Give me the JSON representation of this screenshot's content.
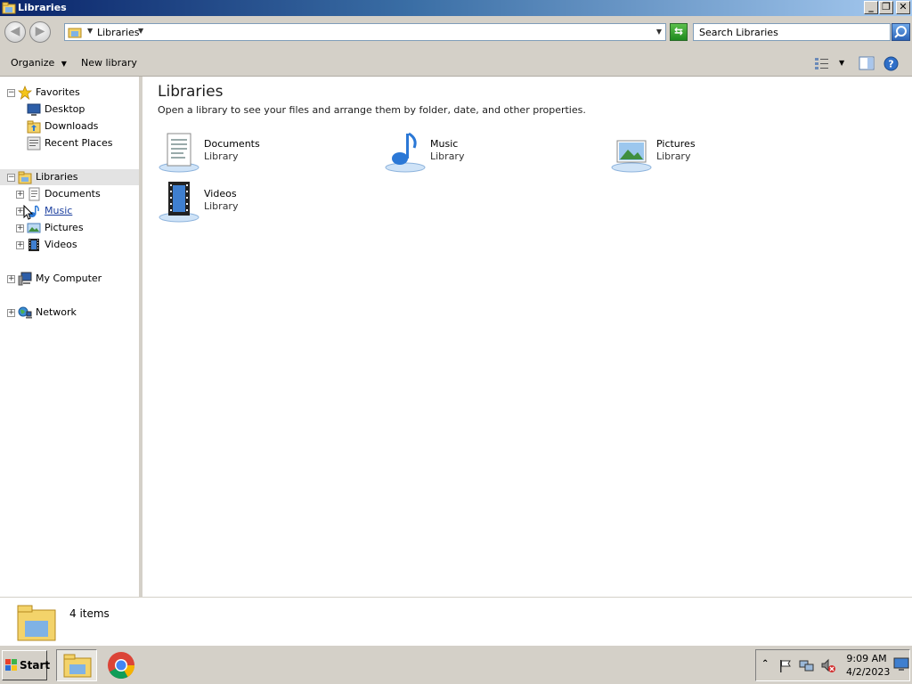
{
  "window": {
    "title": "Libraries"
  },
  "address": {
    "path": "Libraries",
    "search_placeholder": "Search Libraries"
  },
  "toolbar": {
    "organize": "Organize",
    "new_library": "New library"
  },
  "nav": {
    "favorites": "Favorites",
    "favorites_items": [
      "Desktop",
      "Downloads",
      "Recent Places"
    ],
    "libraries": "Libraries",
    "libraries_items": [
      "Documents",
      "Music",
      "Pictures",
      "Videos"
    ],
    "computer": "My Computer",
    "network": "Network"
  },
  "content": {
    "title": "Libraries",
    "subtitle": "Open a library to see your files and arrange them by folder, date, and other properties.",
    "libraries": [
      {
        "name": "Documents",
        "type": "Library"
      },
      {
        "name": "Music",
        "type": "Library"
      },
      {
        "name": "Pictures",
        "type": "Library"
      },
      {
        "name": "Videos",
        "type": "Library"
      }
    ]
  },
  "status": {
    "count": "4 items"
  },
  "taskbar": {
    "start": "Start",
    "time": "9:09 AM",
    "date": "4/2/2023"
  },
  "colors": {
    "title_bar": "#0a246a",
    "chrome": "#d4d0c8",
    "selection": "#e3e3e3"
  }
}
